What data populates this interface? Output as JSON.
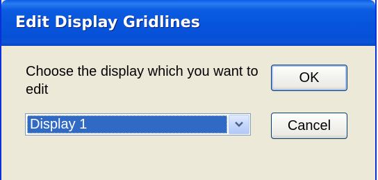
{
  "window": {
    "title": "Edit Display Gridlines"
  },
  "dialog": {
    "prompt": "Choose the display which you want to edit",
    "display_select": {
      "selected": "Display 1"
    },
    "ok_label": "OK",
    "cancel_label": "Cancel"
  },
  "colors": {
    "titlebar": "#0855dd",
    "dialog_bg": "#ece9d8",
    "selection": "#316ac5"
  },
  "icons": {
    "dropdown": "chevron-down-icon"
  }
}
